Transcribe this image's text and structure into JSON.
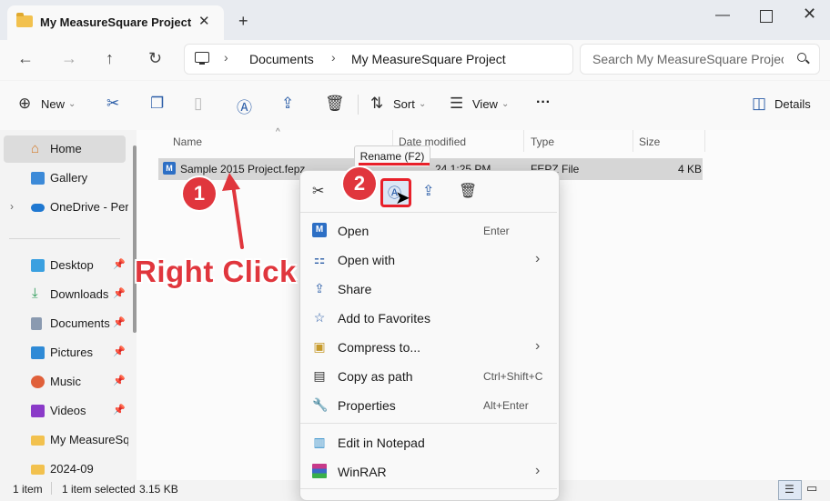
{
  "window": {
    "tab_title": "My MeasureSquare Project",
    "new_tab": "+",
    "close_tab": "✕",
    "minimize": "—",
    "close": "✕"
  },
  "nav": {
    "back": "←",
    "forward": "→",
    "up": "↑",
    "refresh": "↻"
  },
  "breadcrumb": [
    "Documents",
    "My MeasureSquare Project"
  ],
  "search": {
    "placeholder": "Search My MeasureSquare Project"
  },
  "toolbar": {
    "new_label": "New",
    "sort_label": "Sort",
    "view_label": "View",
    "more_label": "···",
    "details_label": "Details"
  },
  "sidebar": {
    "items": [
      {
        "label": "Home",
        "icon": "home-icon",
        "selected": true
      },
      {
        "label": "Gallery",
        "icon": "gallery-icon"
      },
      {
        "label": "OneDrive - Perso",
        "icon": "onedrive-icon"
      },
      {
        "label": "Desktop",
        "icon": "desktop-icon",
        "pinned": true
      },
      {
        "label": "Downloads",
        "icon": "downloads-icon",
        "pinned": true
      },
      {
        "label": "Documents",
        "icon": "documents-icon",
        "pinned": true
      },
      {
        "label": "Pictures",
        "icon": "pictures-icon",
        "pinned": true
      },
      {
        "label": "Music",
        "icon": "music-icon",
        "pinned": true
      },
      {
        "label": "Videos",
        "icon": "videos-icon",
        "pinned": true
      },
      {
        "label": "My MeasureSqua",
        "icon": "folder-icon"
      },
      {
        "label": "2024-09",
        "icon": "folder-icon"
      }
    ]
  },
  "columns": {
    "name": "Name",
    "date": "Date modified",
    "type": "Type",
    "size": "Size"
  },
  "file": {
    "name": "Sample 2015 Project.fepz",
    "date": "24 1:25 PM",
    "type": "FEPZ File",
    "size": "4 KB"
  },
  "status": {
    "count": "1 item",
    "selected": "1 item selected",
    "size": "3.15 KB"
  },
  "tooltip": "Rename (F2)",
  "context_menu": {
    "items": [
      {
        "label": "Open",
        "shortcut": "Enter",
        "icon": "open-icon"
      },
      {
        "label": "Open with",
        "shortcut": "",
        "icon": "open-with-icon",
        "submenu": true
      },
      {
        "label": "Share",
        "shortcut": "",
        "icon": "share-icon"
      },
      {
        "label": "Add to Favorites",
        "shortcut": "",
        "icon": "star-icon"
      },
      {
        "label": "Compress to...",
        "shortcut": "",
        "icon": "compress-icon",
        "submenu": true
      },
      {
        "label": "Copy as path",
        "shortcut": "Ctrl+Shift+C",
        "icon": "copy-path-icon"
      },
      {
        "label": "Properties",
        "shortcut": "Alt+Enter",
        "icon": "properties-icon"
      }
    ],
    "extra_items": [
      {
        "label": "Edit in Notepad",
        "icon": "notepad-icon"
      },
      {
        "label": "WinRAR",
        "icon": "winrar-icon",
        "submenu": true
      }
    ]
  },
  "annotations": {
    "step1": "1",
    "step2": "2",
    "right_click": "Right Click",
    "color": "#e0363d"
  }
}
